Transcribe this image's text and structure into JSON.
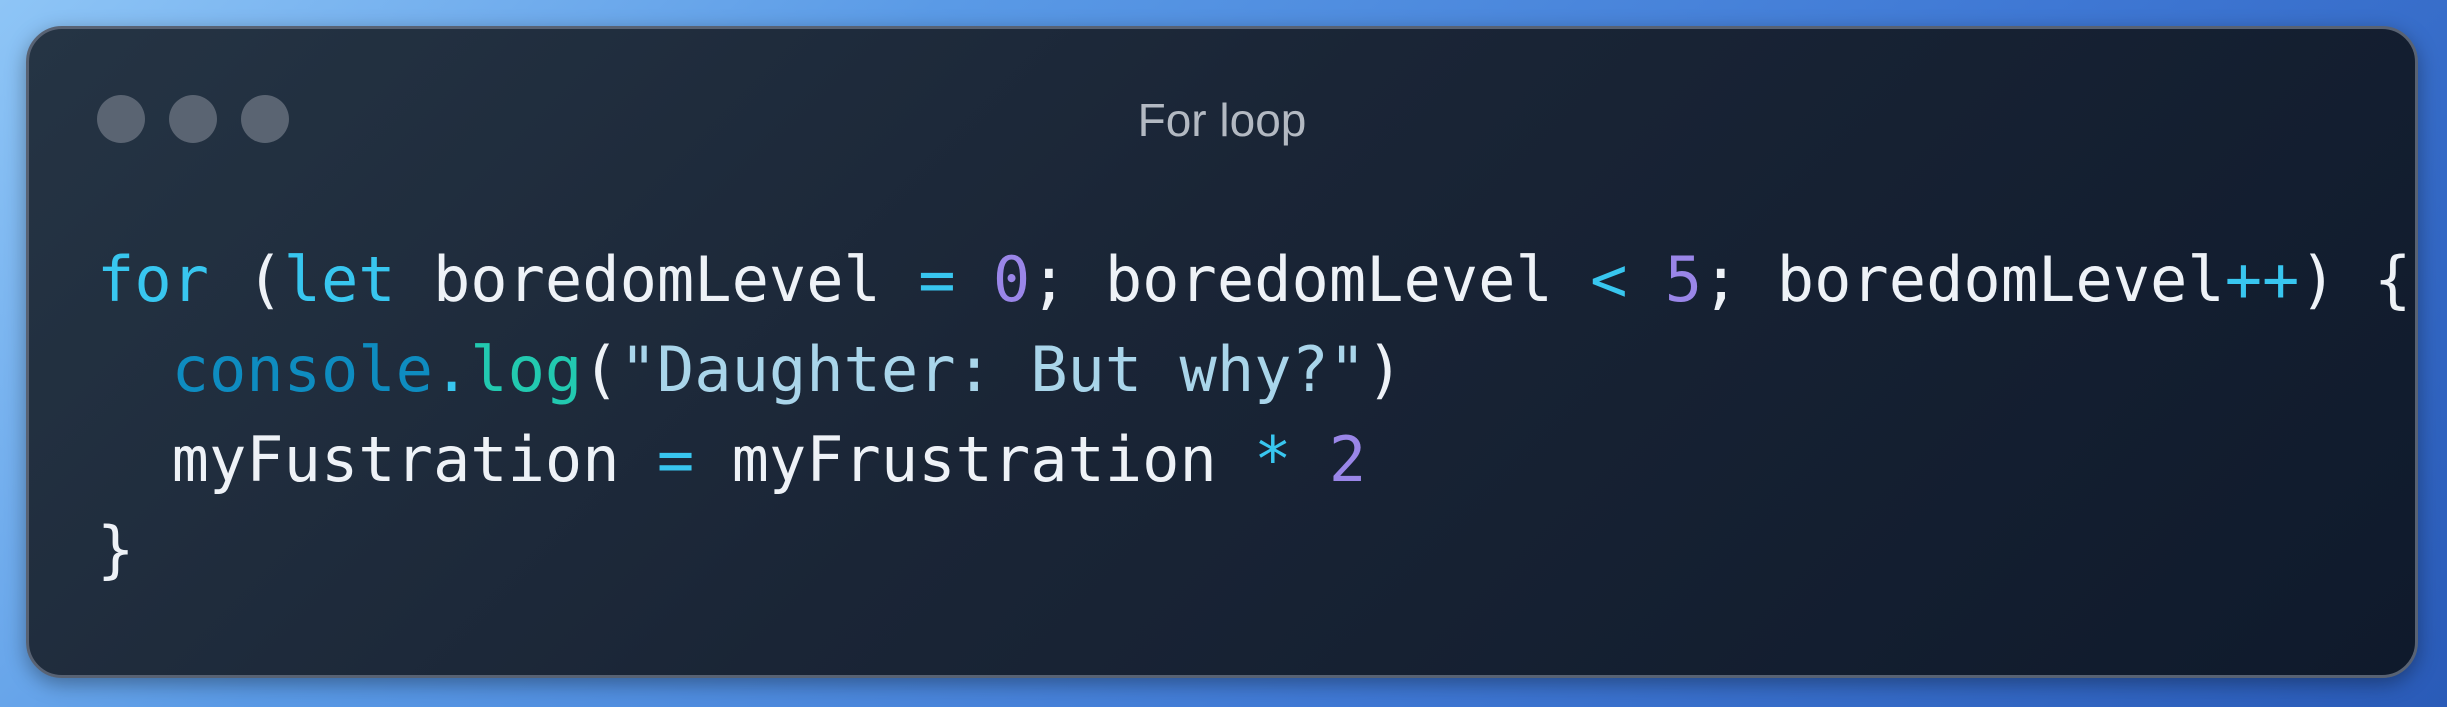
{
  "window": {
    "title": "For loop"
  },
  "code": {
    "language": "javascript",
    "lines": [
      [
        {
          "text": "for",
          "kind": "keyword"
        },
        {
          "text": " (",
          "kind": "text"
        },
        {
          "text": "let",
          "kind": "keyword"
        },
        {
          "text": " boredomLevel ",
          "kind": "text"
        },
        {
          "text": "=",
          "kind": "operator"
        },
        {
          "text": " ",
          "kind": "text"
        },
        {
          "text": "0",
          "kind": "number"
        },
        {
          "text": "; boredomLevel ",
          "kind": "text"
        },
        {
          "text": "<",
          "kind": "operator"
        },
        {
          "text": " ",
          "kind": "text"
        },
        {
          "text": "5",
          "kind": "number"
        },
        {
          "text": "; boredomLevel",
          "kind": "text"
        },
        {
          "text": "++",
          "kind": "operator"
        },
        {
          "text": ") {",
          "kind": "text"
        }
      ],
      [
        {
          "text": "  ",
          "kind": "text"
        },
        {
          "text": "console",
          "kind": "object"
        },
        {
          "text": ".",
          "kind": "operator"
        },
        {
          "text": "log",
          "kind": "function"
        },
        {
          "text": "(",
          "kind": "text"
        },
        {
          "text": "\"Daughter: But why?\"",
          "kind": "string"
        },
        {
          "text": ")",
          "kind": "text"
        }
      ],
      [
        {
          "text": "  myFustration ",
          "kind": "text"
        },
        {
          "text": "=",
          "kind": "operator"
        },
        {
          "text": " myFrustration ",
          "kind": "text"
        },
        {
          "text": "*",
          "kind": "operator"
        },
        {
          "text": " ",
          "kind": "text"
        },
        {
          "text": "2",
          "kind": "number"
        }
      ],
      [
        {
          "text": "}",
          "kind": "text"
        }
      ]
    ]
  },
  "colors": {
    "keyword": "#38c6ef",
    "operator": "#38c6ef",
    "number": "#9a86e8",
    "text": "#eef2f7",
    "object": "#0e8cc0",
    "function": "#22c9b0",
    "string": "#a9d5ea",
    "window_dots": "#5a6472",
    "title": "#b3b9c2"
  }
}
